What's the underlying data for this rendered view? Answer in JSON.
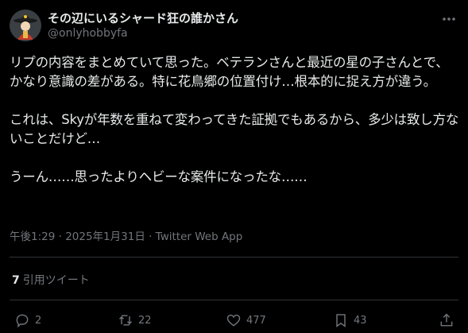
{
  "author": {
    "display_name": "その辺にいるシャード狂の誰かさん",
    "handle": "@onlyhobbyfa"
  },
  "tweet": {
    "paragraphs": [
      "リプの内容をまとめていて思った。ベテランさんと最近の星の子さんとで、かなり意識の差がある。特に花鳥郷の位置付け…根本的に捉え方が違う。",
      "これは、Skyが年数を重ねて変わってきた証拠でもあるから、多少は致し方ないことだけど…",
      "うーん……思ったよりヘビーな案件になったな……"
    ],
    "meta": "午後1:29 · 2025年1月31日 · Twitter Web App"
  },
  "quotes": {
    "count": "7",
    "label": "引用ツイート"
  },
  "actions": {
    "reply_count": "2",
    "retweet_count": "22",
    "like_count": "477",
    "bookmark_count": "43"
  },
  "colors": {
    "background": "#000000",
    "text": "#e7e9ea",
    "secondary": "#71767b",
    "divider": "#2f3336"
  },
  "icons": [
    "more-icon",
    "reply-icon",
    "retweet-icon",
    "like-icon",
    "bookmark-icon",
    "share-icon"
  ]
}
